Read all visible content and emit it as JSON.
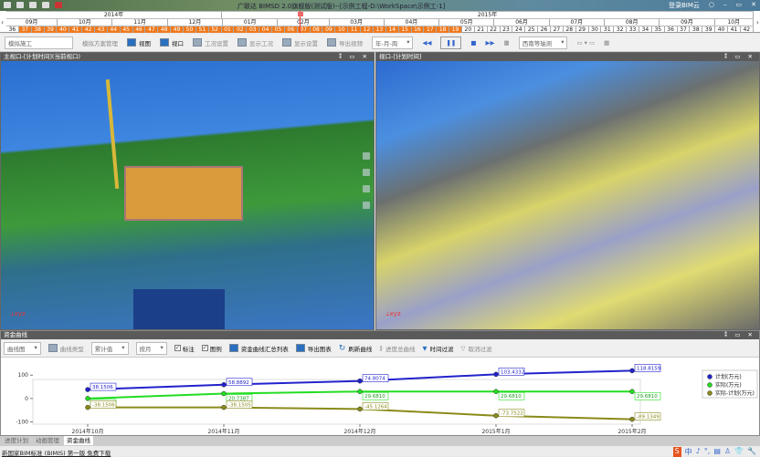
{
  "window": {
    "title": "广联达 BIMSD 2.0旗舰版(测试版)--[示例工程-D:\\WorkSpace\\示例工-1]",
    "login": "登录BIM云",
    "controls": [
      "○",
      "–",
      "▭",
      "✕"
    ]
  },
  "timeline": {
    "years": [
      "2014年",
      "2015年"
    ],
    "months": [
      "09月",
      "10月",
      "11月",
      "12月",
      "01月",
      "02月",
      "03月",
      "04月",
      "05月",
      "06月",
      "07月",
      "08月",
      "09月",
      "10月"
    ],
    "weeks": [
      "36",
      "37",
      "38",
      "39",
      "40",
      "41",
      "42",
      "43",
      "44",
      "45",
      "46",
      "47",
      "48",
      "49",
      "50",
      "51",
      "52",
      "01",
      "02",
      "03",
      "04",
      "05",
      "06",
      "07",
      "08",
      "09",
      "10",
      "11",
      "12",
      "13",
      "14",
      "15",
      "16",
      "17",
      "18",
      "19",
      "20",
      "21",
      "22",
      "23",
      "24",
      "25",
      "26",
      "27",
      "28",
      "29",
      "30",
      "31",
      "32",
      "33",
      "34",
      "35",
      "36",
      "37",
      "38",
      "39",
      "40",
      "41",
      "42"
    ],
    "highlighted_through_index": 35,
    "highlight_color": "#f07a1e"
  },
  "toolbar": {
    "mode_select": "模拟施工",
    "scheme_manage": "模拟方案管理",
    "view": "视图",
    "viewport": "视口",
    "condition_settings": "工况设置",
    "show_condition": "显示工况",
    "display_settings": "显示设置",
    "export_video": "导出视频",
    "period_select": "年-月-周",
    "view_direction": "西南等轴测"
  },
  "viewports": [
    {
      "title": "主视口-[计划时间](当前视口)",
      "controls": "⁑ ▭ ✕"
    },
    {
      "title": "视口-[计划时间]",
      "controls": "⁑ ▭ ✕"
    }
  ],
  "panel": {
    "title": "资金曲线",
    "chart_select": "曲线图",
    "curve_type": "曲线类型",
    "accumulate_select": "累计值",
    "period_select": "按月",
    "label_check": {
      "label": "标注",
      "checked": true
    },
    "legend_check": {
      "label": "图例",
      "checked": true
    },
    "summary_table": "资金曲线汇总列表",
    "export_chart": "导出图表",
    "refresh": "刷新曲线",
    "progress_curve": "进度总曲线",
    "time_filter": "时间过滤",
    "cancel_filter": "取消过滤"
  },
  "chart_data": {
    "type": "line",
    "categories": [
      "2014年10月",
      "2014年11月",
      "2014年12月",
      "2015年1月",
      "2015年2月"
    ],
    "series": [
      {
        "name": "计划(万元)",
        "color": "#2222cc",
        "values": [
          38.1506,
          58.8892,
          74.8074,
          103.4332,
          118.8159
        ]
      },
      {
        "name": "实际(万元)",
        "color": "#22dd22",
        "values": [
          0,
          20.7387,
          29.681,
          29.681,
          29.681
        ]
      },
      {
        "name": "实际-计划(万元)",
        "color": "#8a8a1a",
        "values": [
          -38.1506,
          -38.1505,
          -45.1264,
          -73.7522,
          -89.1349
        ]
      }
    ],
    "data_labels": [
      [
        "38.1506",
        "58.8892",
        "74.8074",
        "103.4332",
        "118.8159"
      ],
      [
        "0",
        "20.7387",
        "29.6810",
        "29.6810",
        "29.6810"
      ],
      [
        "-38.1506",
        "-38.1505",
        "-45.1264",
        "-73.7522",
        "-89.1349"
      ]
    ],
    "yticks": [
      "100",
      "0",
      "-100"
    ],
    "ylim": [
      -110,
      140
    ],
    "grid": false,
    "legend": "right"
  },
  "tabs": [
    "进度计划",
    "动画管理",
    "资金曲线"
  ],
  "active_tab": 2,
  "status": {
    "link": "新国家BIM标准 (BIMIS) 第一版 免费下载",
    "ime": [
      "S",
      "中",
      "♪",
      "°,",
      "▤",
      "♙",
      "👕",
      "🔧"
    ]
  }
}
